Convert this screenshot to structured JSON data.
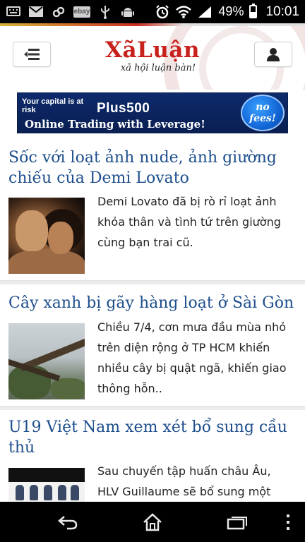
{
  "status_bar": {
    "left_icons": [
      "keyboard-icon",
      "gmail-icon",
      "link-icon",
      "ebay-icon",
      "usb-icon",
      "android-icon"
    ],
    "ebay_label": "ebay",
    "right_icons": [
      "alarm-icon",
      "wifi-icon",
      "signal-icon",
      "battery-icon"
    ],
    "battery_percent": "49%",
    "battery_level": 0.49,
    "time": "10:01"
  },
  "header": {
    "logo": "XãLuận",
    "tagline": "xã hội luận bàn!",
    "menu_icon": "menu-icon",
    "user_icon": "user-icon",
    "accent_color": "#c8201c",
    "link_color": "#1e4f8c"
  },
  "ad": {
    "risk_text": "Your capital is at risk",
    "brand": "Plus500",
    "tagline": "Online Trading with Leverage!",
    "badge_line1": "no",
    "badge_line2": "fees!"
  },
  "articles": [
    {
      "title": "Sốc với loạt ảnh nude, ảnh giường chiếu của Demi Lovato",
      "description": "Demi Lovato đã bị rò rỉ loạt ảnh khỏa thân và tình tứ trên giường cùng bạn trai cũ."
    },
    {
      "title": "Cây xanh bị gãy hàng loạt ở Sài Gòn",
      "description": "Chiều 7/4, cơn mưa đầu mùa nhỏ trên diện rộng ở TP HCM khiến nhiều cây bị quật ngã, khiến giao thông hỗn.."
    },
    {
      "title": "U19 Việt Nam xem xét bổ sung cầu thủ",
      "description": "Sau chuyến tập huấn châu Âu, HLV Guillaume sẽ bổ sung một"
    }
  ],
  "nav_bar": {
    "icons": [
      "back-icon",
      "home-icon",
      "recent-apps-icon",
      "overflow-menu-icon"
    ]
  }
}
